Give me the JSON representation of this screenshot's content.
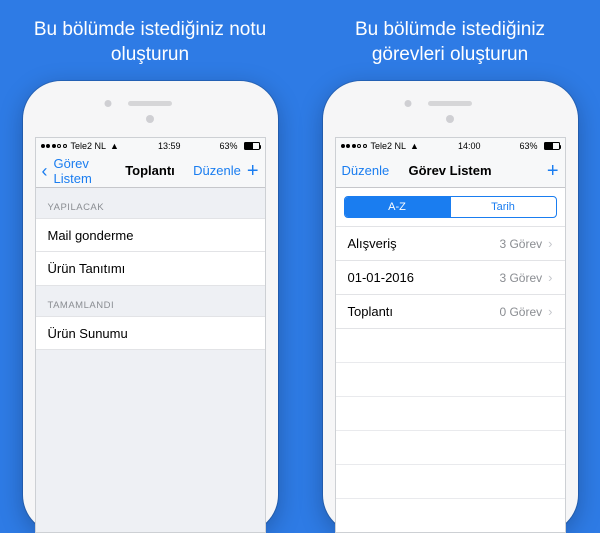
{
  "left": {
    "caption": "Bu bölümde istediğiniz notu oluşturun",
    "status": {
      "carrier": "Tele2 NL",
      "time": "13:59",
      "battery": "63%"
    },
    "nav": {
      "back": "Görev Listem",
      "title": "Toplantı",
      "edit": "Düzenle"
    },
    "section_todo": "YAPILACAK",
    "todo": [
      "Mail gonderme",
      "Ürün Tanıtımı"
    ],
    "section_done": "TAMAMLANDI",
    "done": [
      "Ürün Sunumu"
    ]
  },
  "right": {
    "caption": "Bu bölümde istediğiniz görevleri oluşturun",
    "status": {
      "carrier": "Tele2 NL",
      "time": "14:00",
      "battery": "63%"
    },
    "nav": {
      "edit": "Düzenle",
      "title": "Görev Listem"
    },
    "seg": {
      "az": "A-Z",
      "tarih": "Tarih"
    },
    "lists": [
      {
        "name": "Alışveriş",
        "count": "3 Görev"
      },
      {
        "name": "01-01-2016",
        "count": "3 Görev"
      },
      {
        "name": "Toplantı",
        "count": "0 Görev"
      }
    ]
  }
}
